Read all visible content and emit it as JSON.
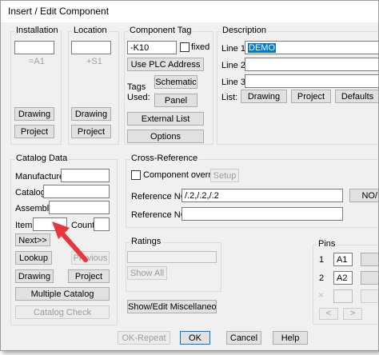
{
  "window": {
    "title": "Insert / Edit Component"
  },
  "installation": {
    "title": "Installation",
    "value": "",
    "hint": "=A1",
    "drawing": "Drawing",
    "project": "Project"
  },
  "location": {
    "title": "Location",
    "value": "",
    "hint": "+S1",
    "drawing": "Drawing",
    "project": "Project"
  },
  "component_tag": {
    "title": "Component Tag",
    "value": "-K10",
    "fixed_label": "fixed",
    "use_plc": "Use PLC Address",
    "tags_used": "Tags\nUsed:",
    "schematic": "Schematic",
    "panel": "Panel",
    "external_list": "External List",
    "options": "Options"
  },
  "description": {
    "title": "Description",
    "line1_label": "Line 1",
    "line1_value": "DEMO",
    "line2_label": "Line 2",
    "line3_label": "Line 3",
    "list_label": "List:",
    "drawing": "Drawing",
    "project": "Project",
    "defaults": "Defaults"
  },
  "catalog": {
    "title": "Catalog Data",
    "manufacturer": "Manufacturer",
    "catalog": "Catalog",
    "assembly": "Assembly",
    "item": "Item",
    "count": "Count",
    "next": "Next>>",
    "lookup": "Lookup",
    "previous": "Previous",
    "drawing": "Drawing",
    "project": "Project",
    "multiple_catalog": "Multiple Catalog",
    "catalog_check": "Catalog Check"
  },
  "cross_reference": {
    "title": "Cross-Reference",
    "override": "Component override",
    "setup": "Setup",
    "ref_no_label": "Reference NO",
    "ref_no_value": "/.2,/.2,/.2",
    "no_btn": "NO/",
    "ref_nc_label": "Reference NC"
  },
  "ratings": {
    "title": "Ratings",
    "show_all": "Show All"
  },
  "show_misc": "Show/Edit Miscellaneous",
  "pins": {
    "title": "Pins",
    "pin1_label": "1",
    "pin1_value": "A1",
    "pin2_label": "2",
    "pin2_value": "A2",
    "x_mark": "×",
    "prev": "<",
    "next": ">"
  },
  "footer": {
    "ok_repeat": "OK-Repeat",
    "ok": "OK",
    "cancel": "Cancel",
    "help": "Help"
  },
  "annotation": {
    "color": "#e8363d"
  }
}
